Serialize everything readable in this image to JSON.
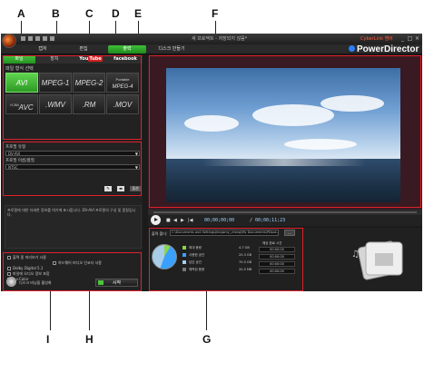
{
  "callouts": {
    "a": "A",
    "b": "B",
    "c": "C",
    "d": "D",
    "e": "E",
    "f": "F",
    "g": "G",
    "h": "H",
    "i": "I"
  },
  "titlebar": {
    "title": "새 프로젝트 - 저장되지 않음*",
    "brand_link": "CyberLink 멤버",
    "minimize": "_",
    "maximize": "□",
    "close": "×"
  },
  "menu": {
    "tabs": [
      "캡처",
      "편집",
      "출력",
      "디스크 만들기"
    ],
    "active_index": 2
  },
  "app_logo": "PowerDirector",
  "subtabs": {
    "file": "파일",
    "device": "장치",
    "youtube_you": "You",
    "youtube_tube": "Tube",
    "facebook": "facebook"
  },
  "formats": {
    "label": "파일 형식 선택",
    "items": [
      "AVI",
      "MPEG-1",
      "MPEG-2",
      "Portable",
      "MPEG-4",
      "H.264",
      "AVC",
      ".WMV",
      ".RM",
      ".MOV"
    ],
    "selected": "AVI"
  },
  "options": {
    "profile_label": "프로필 유형",
    "profile_value": "DV-AVI",
    "quality_label": "프로필 이름/품질",
    "quality_value": "NTSC",
    "option_button": "옵션"
  },
  "description": "프로필에 대한 자세한 정보를 여기에 표시합니다. DV-AVI 프로필의 구성 및 품질입니다.",
  "settings": {
    "items": [
      "출력 중 미리보기 사용",
      "하드웨어 비디오 인코더 사용",
      "Dolby Digital 5.1",
      "파일에 오디오 정보 포함",
      "x.v.Color"
    ],
    "disc_text": "디스크 버닝을 활성화",
    "start_button": "시작"
  },
  "player": {
    "timecode_current": "00;00;00;00",
    "timecode_total": "00;00;11;23",
    "stop": "■",
    "prev": "◀",
    "next": "▶",
    "seek": "|◀"
  },
  "output": {
    "folder_label": "출력 폴더:",
    "folder_path": "C:\\Documents and Settings\\kingsmy_cheng\\My Documents\\PDout.avi",
    "browse": "...",
    "legend": [
      {
        "name": "최대 용량",
        "value": "4.7 GB",
        "color": "#8fd44a"
      },
      {
        "name": "사용한 공간",
        "value": "20.3 GB",
        "color": "#3aa0ff"
      },
      {
        "name": "남은 공간",
        "value": "70.0 GB",
        "color": "#a8cde8"
      },
      {
        "name": "예측된 용량",
        "value": "20.5 MB",
        "color": "#777777"
      }
    ],
    "estimated_label": "예상 완료 시간",
    "estimated_values": [
      "00:00:00",
      "00:00:00",
      "00:00:00",
      "00:00:00"
    ]
  }
}
